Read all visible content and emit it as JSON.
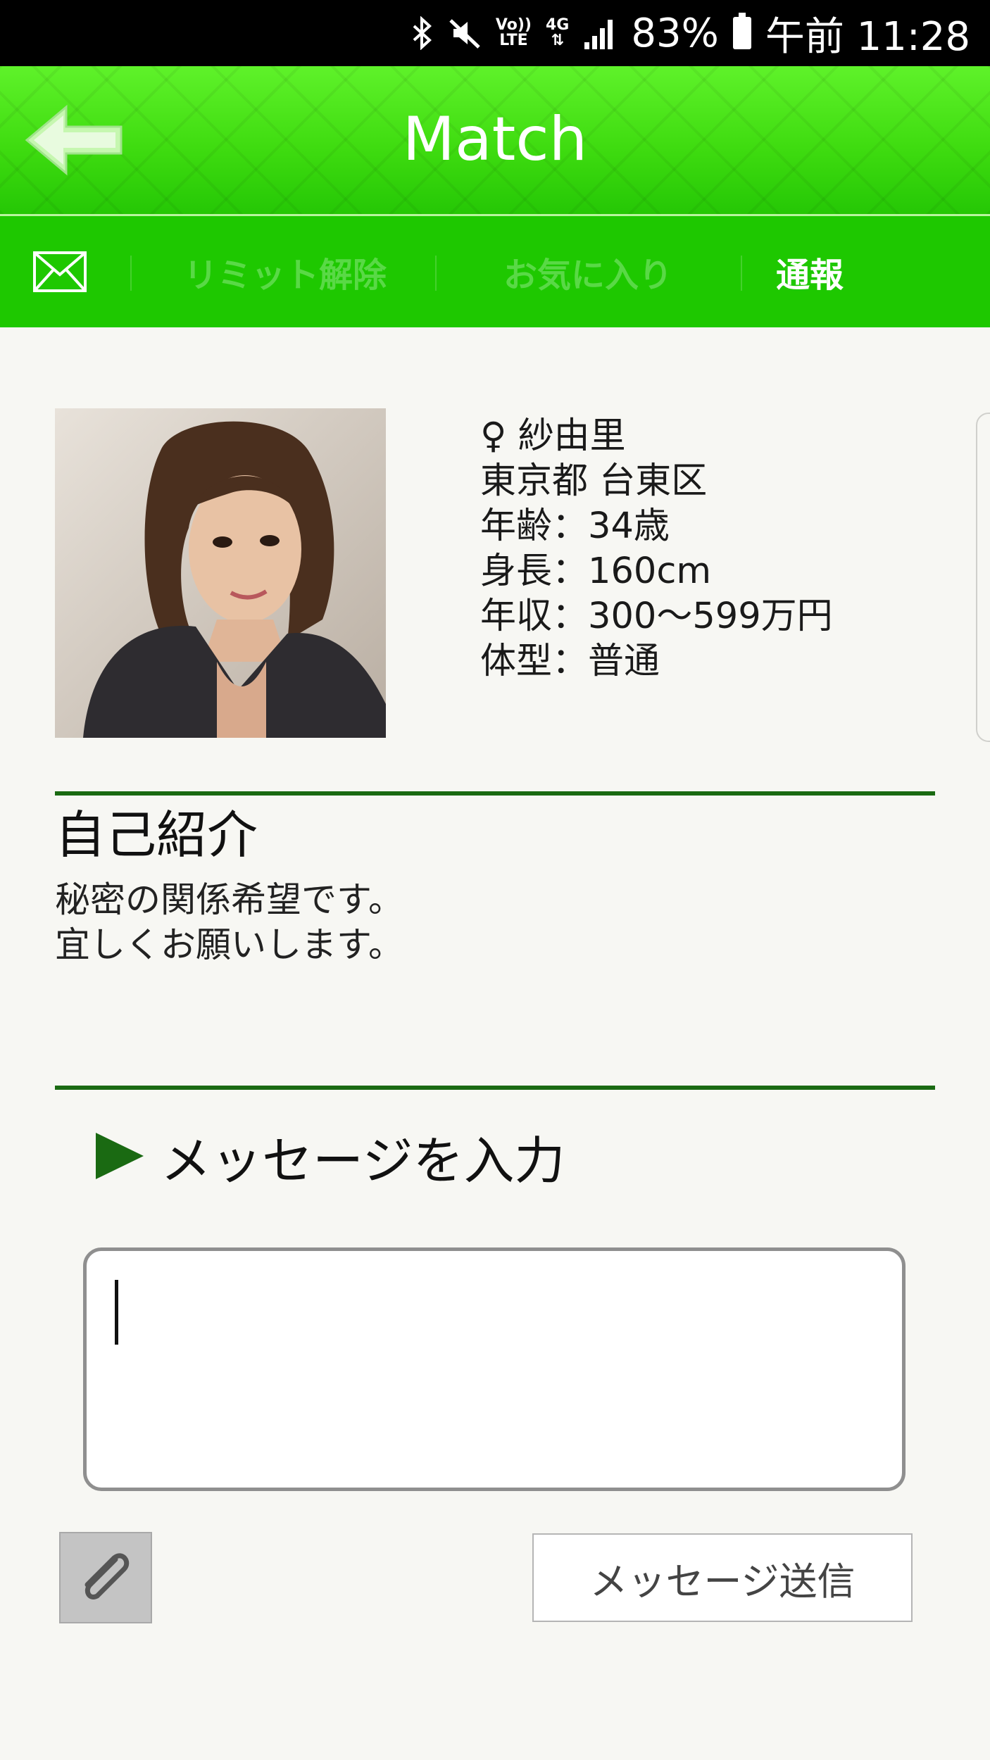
{
  "status_bar": {
    "lte_top": "Vo))",
    "lte_bottom": "LTE",
    "network": "4G",
    "battery": "83%",
    "time": "午前 11:28",
    "icons": [
      "bluetooth-icon",
      "mute-icon",
      "volte-icon",
      "4g-icon",
      "signal-icon",
      "battery-icon"
    ]
  },
  "header": {
    "title": "Match",
    "back_icon": "arrow-left-icon"
  },
  "actions": {
    "mail_icon": "envelope-icon",
    "limit_release": "リミット解除",
    "favorite": "お気に入り",
    "report": "通報"
  },
  "profile": {
    "gender_symbol": "♀",
    "name": "紗由里",
    "location": "東京都 台東区",
    "age": "年齢：34歳",
    "height": "身長：160cm",
    "income": "年収：300～599万円",
    "body_type": "体型：普通"
  },
  "intro": {
    "title": "自己紹介",
    "body": "秘密の関係希望です。\n宜しくお願いします。"
  },
  "message": {
    "heading": "メッセージを入力",
    "input_value": "",
    "attach_icon": "paperclip-icon",
    "send_label": "メッセージ送信"
  },
  "colors": {
    "header_green": "#3fdc10",
    "actionbar_green": "#1ec800",
    "divider_green": "#1a6a12",
    "background": "#f7f7f3"
  }
}
